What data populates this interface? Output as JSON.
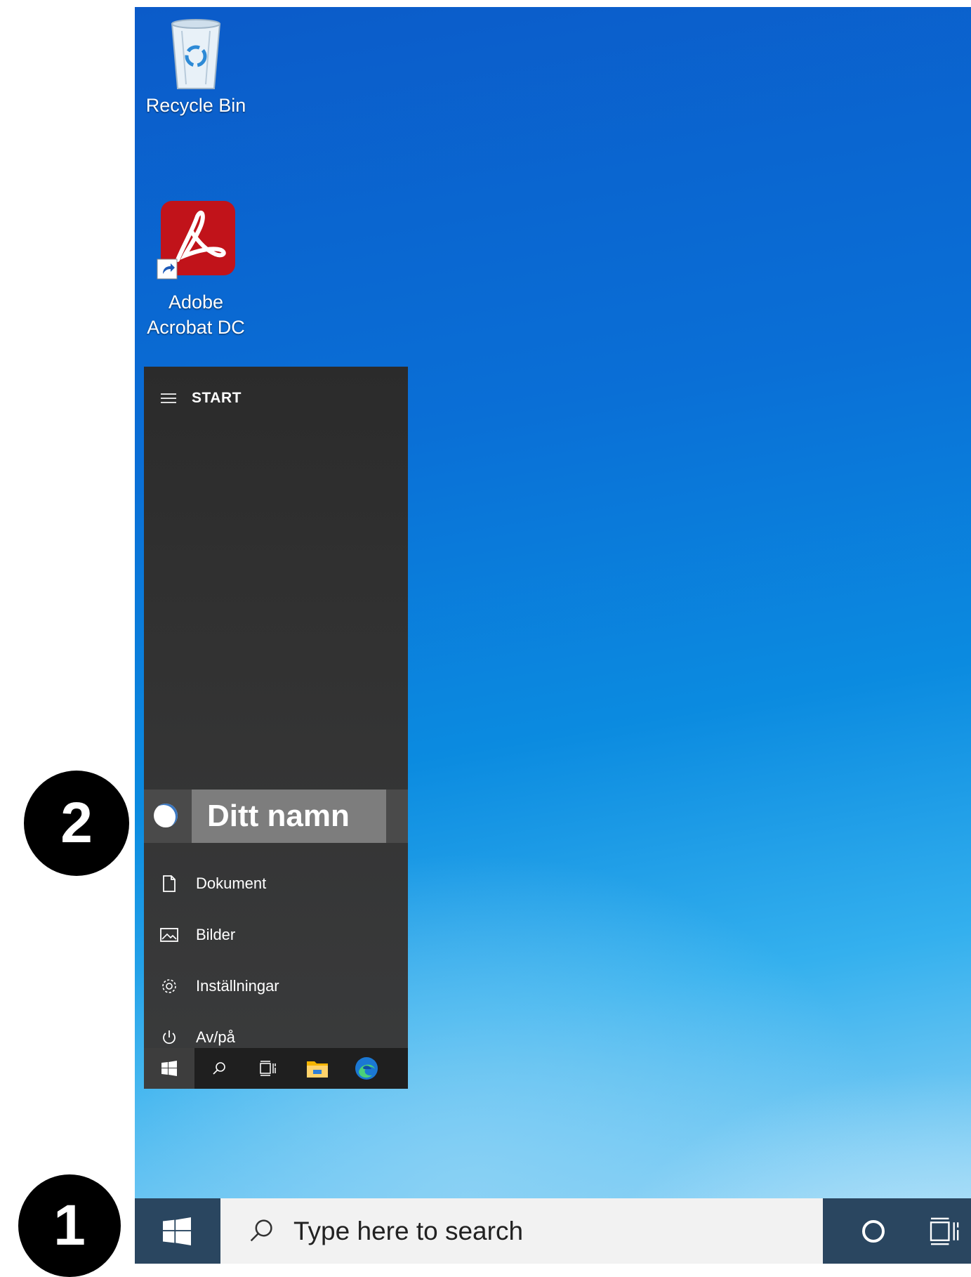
{
  "desktop": {
    "icons": [
      {
        "label": "Recycle Bin",
        "icon": "recycle-bin-icon"
      },
      {
        "label_line1": "Adobe",
        "label_line2": "Acrobat DC",
        "icon": "adobe-acrobat-icon"
      }
    ]
  },
  "start_menu": {
    "title": "START",
    "user": {
      "name": "Ditt namn"
    },
    "items": [
      {
        "label": "Dokument",
        "icon": "document-icon"
      },
      {
        "label": "Bilder",
        "icon": "pictures-icon"
      },
      {
        "label": "Inställningar",
        "icon": "gear-icon"
      },
      {
        "label": "Av/på",
        "icon": "power-icon"
      }
    ]
  },
  "taskbar": {
    "search_placeholder": "Type here to search"
  },
  "callouts": {
    "one": "1",
    "two": "2"
  },
  "colors": {
    "taskbar": "#2a4660",
    "start_menu": "#2b2b2b",
    "acrobat_red": "#c1131a"
  }
}
